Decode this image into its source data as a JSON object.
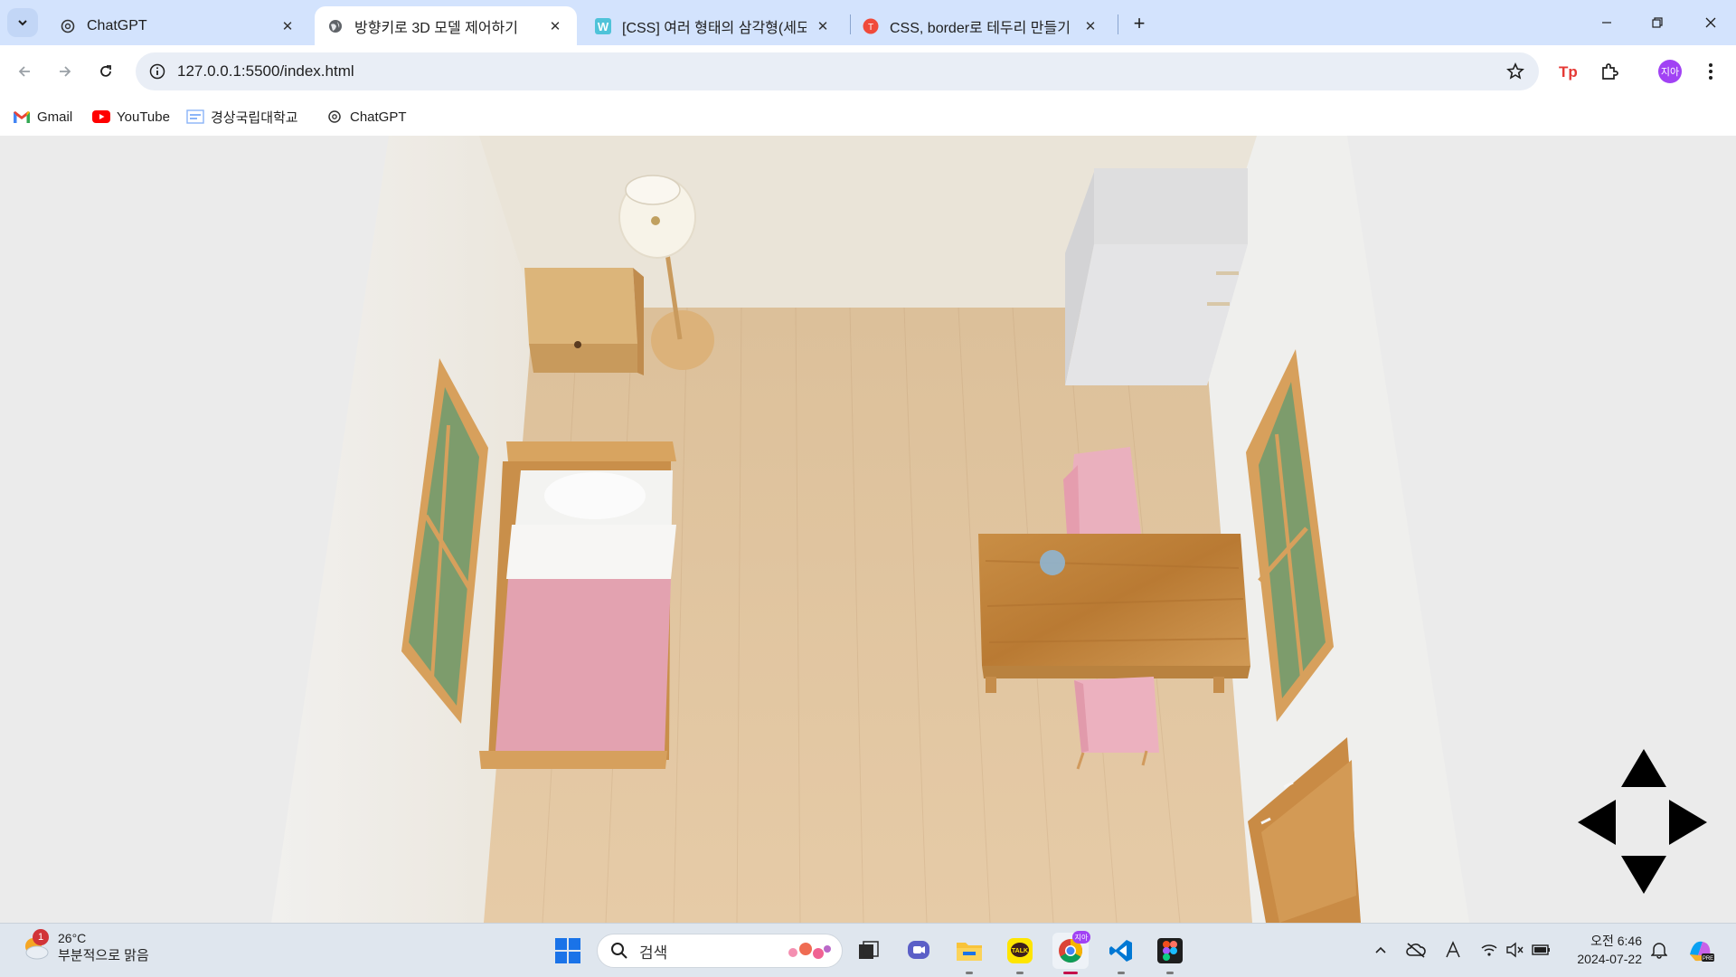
{
  "browser": {
    "tabs": [
      {
        "title": "ChatGPT",
        "favicon": "openai-icon",
        "active": false
      },
      {
        "title": "방향키로 3D 모델 제어하기",
        "favicon": "globe-icon",
        "active": true
      },
      {
        "title": "[CSS] 여러 형태의 삼각형(세모)",
        "favicon": "w-icon",
        "active": false
      },
      {
        "title": "CSS, border로 테두리 만들기 및",
        "favicon": "red-circle-icon",
        "active": false
      }
    ],
    "close_glyph": "✕",
    "new_tab_glyph": "+",
    "url": "127.0.0.1:5500/index.html",
    "profile_initials": "지아",
    "bookmarks": [
      {
        "label": "Gmail",
        "icon": "gmail-icon"
      },
      {
        "label": "YouTube",
        "icon": "youtube-icon"
      },
      {
        "label": "경상국립대학교",
        "icon": "university-icon"
      },
      {
        "label": "ChatGPT",
        "icon": "openai-icon"
      }
    ]
  },
  "scene": {
    "description_colors": {
      "floor": "#e2c49f",
      "wall": "#efe9de",
      "bed_sheet": "#e3a2b0",
      "chair": "#eeb2c0",
      "wood": "#d6a35e",
      "window_glass": "#7f9e70"
    },
    "controls": [
      "arrow-up",
      "arrow-left",
      "arrow-right",
      "arrow-down"
    ]
  },
  "taskbar": {
    "weather": {
      "temp": "26°C",
      "condition": "부분적으로 맑음",
      "badge": "1"
    },
    "search_placeholder": "검색",
    "apps": [
      "start-icon",
      "file-explorer-icon",
      "chat-icon",
      "folder-icon",
      "kakaotalk-icon",
      "chrome-icon",
      "vscode-icon",
      "figma-icon"
    ],
    "chrome_badge": "지아",
    "clock": {
      "time": "오전 6:46",
      "date": "2024-07-22"
    }
  }
}
